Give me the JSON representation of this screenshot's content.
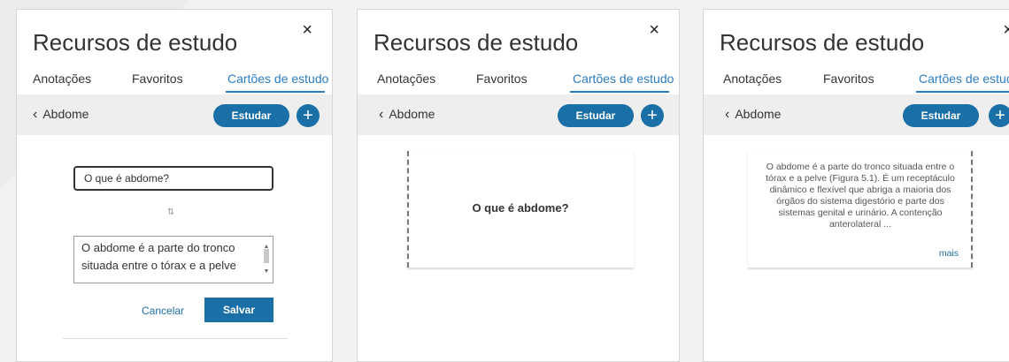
{
  "panel_title": "Recursos de estudo",
  "close_icon": "×",
  "tabs": [
    "Anotações",
    "Favoritos",
    "Cartões de estudo"
  ],
  "tabs_truncated_last": "Cartões de estud",
  "back_label": "Abdome",
  "back_icon": "‹",
  "study_label": "Estudar",
  "add_icon": "+",
  "edit": {
    "question_value": "O que é abdome?",
    "swap_icon": "⇅",
    "answer_value": "O abdome é a parte do tronco situada entre o tórax e a pelve",
    "cancel_label": "Cancelar",
    "save_label": "Salvar"
  },
  "card_front": {
    "question": "O que é abdome?"
  },
  "card_back": {
    "answer": "O abdome é a parte do tronco situada entre o tórax e a pelve (Figura 5.1). É um receptáculo dinâmico e flexível que abriga a maioria dos órgãos do sistema digestório e parte dos sistemas genital e urinário. A contenção anterolateral ...",
    "more_label": "mais"
  },
  "colors": {
    "accent": "#1a6fa6",
    "tab_active": "#2b7cc1",
    "subbar": "#eeeeee"
  }
}
